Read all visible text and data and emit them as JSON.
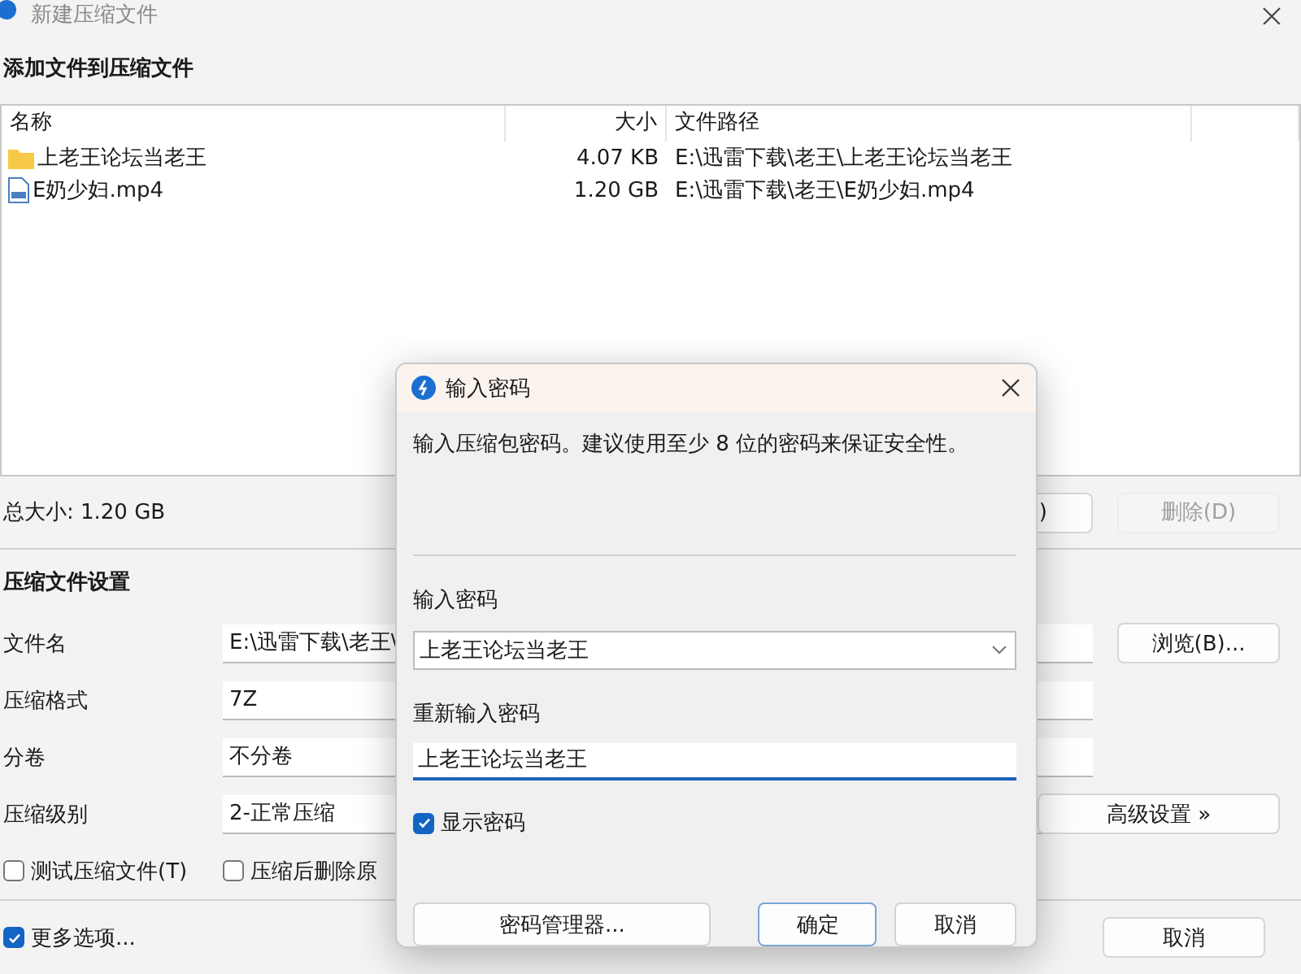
{
  "window": {
    "title": "新建压缩文件"
  },
  "files_section": {
    "heading": "添加文件到压缩文件",
    "columns": [
      "名称",
      "大小",
      "文件路径"
    ],
    "rows": [
      {
        "kind": "folder",
        "name": "上老王论坛当老王",
        "size": "4.07 KB",
        "path": "E:\\迅雷下载\\老王\\上老王论坛当老王"
      },
      {
        "kind": "video",
        "name": "E奶少妇.mp4",
        "size": "1.20 GB",
        "path": "E:\\迅雷下载\\老王\\E奶少妇.mp4"
      }
    ],
    "total_size": "总大小: 1.20 GB",
    "add_button_fragment": ")",
    "delete_button": {
      "label": "删除(D)",
      "disabled": true
    }
  },
  "settings": {
    "heading": "压缩文件设置",
    "fields": [
      {
        "label": "文件名",
        "value": "E:\\迅雷下载\\老王\\"
      },
      {
        "label": "压缩格式",
        "value": "7Z"
      },
      {
        "label": "分卷",
        "value": "不分卷"
      },
      {
        "label": "压缩级别",
        "value": "2-正常压缩"
      }
    ],
    "browse_button": "浏览(B)...",
    "advanced_button": "高级设置 »",
    "options": [
      {
        "label": "测试压缩文件(T)",
        "checked": false
      },
      {
        "label": "压缩后删除原",
        "checked": false
      }
    ]
  },
  "more_options": {
    "label": "更多选项...",
    "checked": true
  },
  "cancel_button": "取消",
  "dialog": {
    "title": "输入密码",
    "message": "输入压缩包密码。建议使用至少 8 位的密码来保证安全性。",
    "password_label": "输入密码",
    "password_value": "上老王论坛当老王",
    "repeat_label": "重新输入密码",
    "repeat_value": "上老王论坛当老王",
    "show_password": {
      "label": "显示密码",
      "checked": true
    },
    "manager_button": "密码管理器...",
    "ok_button": "确定",
    "cancel_button": "取消"
  }
}
